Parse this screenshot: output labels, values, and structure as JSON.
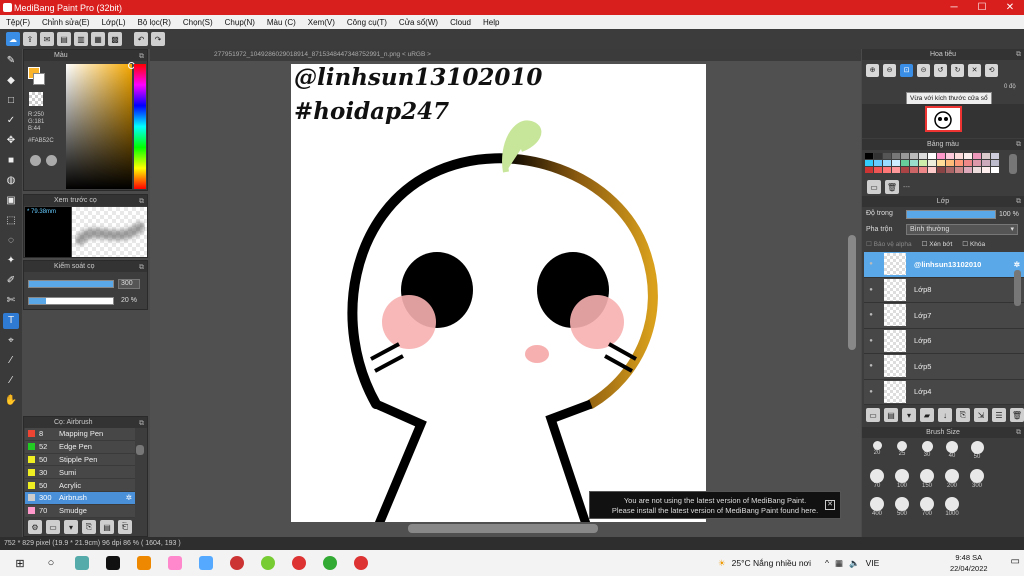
{
  "window": {
    "title": "MediBang Paint Pro (32bit)",
    "min": "─",
    "max": "☐",
    "close": "✕"
  },
  "menu": [
    "Tệp(F)",
    "Chỉnh sửa(E)",
    "Lớp(L)",
    "Bộ lọc(R)",
    "Chọn(S)",
    "Chụp(N)",
    "Màu (C)",
    "Xem(V)",
    "Công cụ(T)",
    "Cửa sổ(W)",
    "Cloud",
    "Help"
  ],
  "color_panel": {
    "title": "Màu",
    "r": "R:250",
    "g": "G:181",
    "b": "B:44",
    "hex": "#FAB52C",
    "fg": "#FAB52C"
  },
  "preview_panel": {
    "title": "Xem trước cọ",
    "size": "79.38mm"
  },
  "control_panel": {
    "title": "Kiểm soát cọ",
    "size_value": "300",
    "size_fraction": 1.0,
    "opacity_value": "20 %",
    "opacity_fraction": 0.2
  },
  "brush_panel": {
    "title": "Cọ: Airbrush",
    "items": [
      {
        "size": "8",
        "name": "Mapping Pen",
        "color": "#e43"
      },
      {
        "size": "52",
        "name": "Edge Pen",
        "color": "#2c2"
      },
      {
        "size": "50",
        "name": "Stipple Pen",
        "color": "#ee2"
      },
      {
        "size": "30",
        "name": "Sumi",
        "color": "#ee2"
      },
      {
        "size": "50",
        "name": "Acrylic",
        "color": "#ee2"
      },
      {
        "size": "300",
        "name": "Airbrush",
        "color": "#ccc",
        "selected": true
      },
      {
        "size": "70",
        "name": "Smudge",
        "color": "#f9c"
      }
    ]
  },
  "document": {
    "tab": "277951972_1049286029018914_8715348447348752991_n.png < uRGB >",
    "text1": "@linhsun13102010",
    "text2": "#hoidap247"
  },
  "notice": {
    "line1": "You are not using the latest version of MediBang Paint.",
    "line2": "Please install the latest version of MediBang Paint found here."
  },
  "navigator": {
    "title": "Hoa tiêu",
    "tooltip": "Vừa với kích thước cửa sổ",
    "angle": "0 độ"
  },
  "palette": {
    "title": "Bảng màu",
    "dash": "---",
    "colors": [
      "#000",
      "#333",
      "#555",
      "#777",
      "#999",
      "#bbb",
      "#ddd",
      "#fff",
      "#f9c",
      "#fcd",
      "#fdd",
      "#fee",
      "#e9b",
      "#dcc",
      "#ccd",
      "#3cf",
      "#6cf",
      "#9df",
      "#cef",
      "#6c9",
      "#9dc",
      "#cea",
      "#eed",
      "#fd9",
      "#fb7",
      "#f97",
      "#e88",
      "#d9a",
      "#cab",
      "#bbc",
      "#c33",
      "#e55",
      "#f77",
      "#f99",
      "#a44",
      "#c66",
      "#e88",
      "#fcc",
      "#844",
      "#a66",
      "#c88",
      "#dab",
      "#edd",
      "#fee",
      "#fff"
    ]
  },
  "layer_panel": {
    "title": "Lớp",
    "opacity_label": "Độ trong",
    "opacity_value": "100 %",
    "opacity_fraction": 1.0,
    "blend_label": "Pha trộn",
    "blend_value": "Bình thường",
    "protect_alpha": "Bảo vệ alpha",
    "clip": "Xén bớt",
    "lock": "Khóa",
    "layers": [
      {
        "name": "@linhsun13102010",
        "selected": true
      },
      {
        "name": "Lớp8"
      },
      {
        "name": "Lớp7"
      },
      {
        "name": "Lớp6"
      },
      {
        "name": "Lớp5"
      },
      {
        "name": "Lớp4"
      }
    ]
  },
  "brush_size": {
    "title": "Brush Size",
    "sizes": [
      "20",
      "25",
      "30",
      "40",
      "50",
      "70",
      "100",
      "150",
      "200",
      "300",
      "400",
      "500",
      "700",
      "1000"
    ]
  },
  "status": {
    "text": "752 * 829 pixel   (19.9 * 21.9cm)   96 dpi   86 %   ( 1604, 193 )"
  },
  "taskbar": {
    "weather": "25°C  Nắng nhiều nơi",
    "lang": "VIE",
    "time": "9:48 SA",
    "date": "22/04/2022",
    "apps": [
      "#ffffff",
      "#5aa",
      "#111",
      "#e80",
      "#fff",
      "#5af",
      "#c33",
      "#fff",
      "#7c3",
      "#d33",
      "#3a3",
      "#d33"
    ]
  }
}
